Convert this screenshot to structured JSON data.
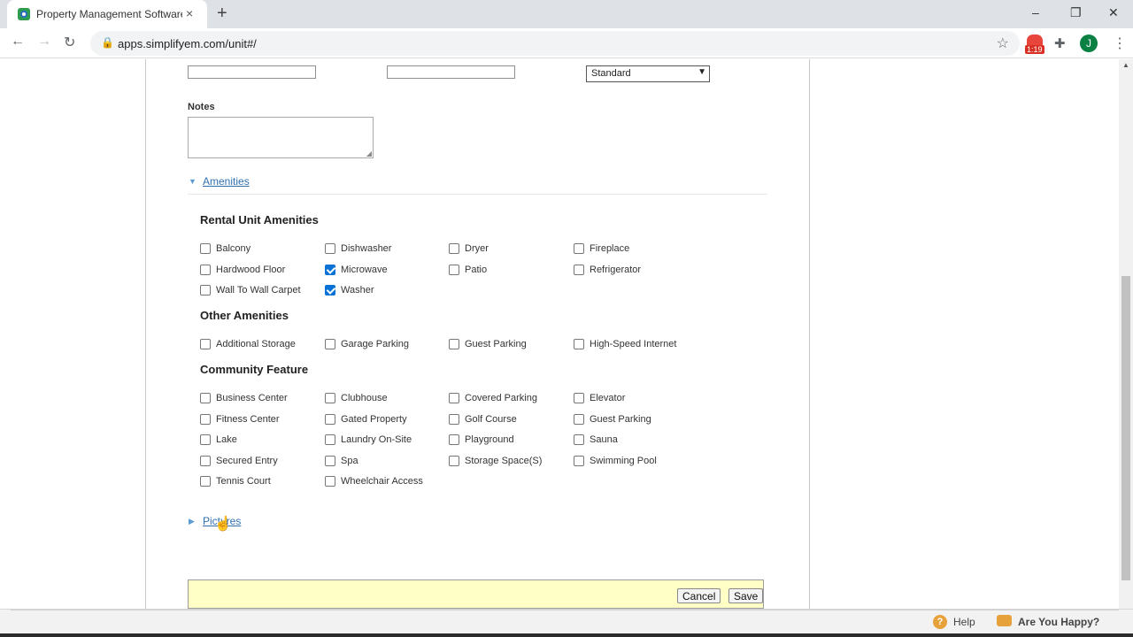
{
  "browser": {
    "tab_title": "Property Management Software",
    "tab_close": "×",
    "new_tab": "+",
    "url": "apps.simplifyem.com/unit#/",
    "extension_badge": "1:19",
    "avatar_letter": "J",
    "window_controls": {
      "minimize": "–",
      "maximize": "❐",
      "close": "✕"
    },
    "nav": {
      "back": "←",
      "forward": "→",
      "reload": "↻"
    }
  },
  "form": {
    "unit_type_select": {
      "value": "Standard"
    },
    "notes": {
      "label": "Notes",
      "value": ""
    },
    "amenities_toggle": "Amenities",
    "pictures_toggle": "Pictures"
  },
  "groups": {
    "rental": {
      "title": "Rental Unit Amenities",
      "items": [
        {
          "label": "Balcony",
          "checked": false
        },
        {
          "label": "Dishwasher",
          "checked": false
        },
        {
          "label": "Dryer",
          "checked": false
        },
        {
          "label": "Fireplace",
          "checked": false
        },
        {
          "label": "Hardwood Floor",
          "checked": false
        },
        {
          "label": "Microwave",
          "checked": true
        },
        {
          "label": "Patio",
          "checked": false
        },
        {
          "label": "Refrigerator",
          "checked": false
        },
        {
          "label": "Wall To Wall Carpet",
          "checked": false
        },
        {
          "label": "Washer",
          "checked": true
        }
      ]
    },
    "other": {
      "title": "Other Amenities",
      "items": [
        {
          "label": "Additional Storage",
          "checked": false
        },
        {
          "label": "Garage Parking",
          "checked": false
        },
        {
          "label": "Guest Parking",
          "checked": false
        },
        {
          "label": "High-Speed Internet",
          "checked": false
        }
      ]
    },
    "community": {
      "title": "Community Feature",
      "items": [
        {
          "label": "Business Center",
          "checked": false
        },
        {
          "label": "Clubhouse",
          "checked": false
        },
        {
          "label": "Covered Parking",
          "checked": false
        },
        {
          "label": "Elevator",
          "checked": false
        },
        {
          "label": "Fitness Center",
          "checked": false
        },
        {
          "label": "Gated Property",
          "checked": false
        },
        {
          "label": "Golf Course",
          "checked": false
        },
        {
          "label": "Guest Parking",
          "checked": false
        },
        {
          "label": "Lake",
          "checked": false
        },
        {
          "label": "Laundry On-Site",
          "checked": false
        },
        {
          "label": "Playground",
          "checked": false
        },
        {
          "label": "Sauna",
          "checked": false
        },
        {
          "label": "Secured Entry",
          "checked": false
        },
        {
          "label": "Spa",
          "checked": false
        },
        {
          "label": "Storage Space(S)",
          "checked": false
        },
        {
          "label": "Swimming Pool",
          "checked": false
        },
        {
          "label": "Tennis Court",
          "checked": false
        },
        {
          "label": "Wheelchair Access",
          "checked": false
        }
      ]
    }
  },
  "actions": {
    "cancel": "Cancel",
    "save": "Save"
  },
  "footer": {
    "help": "Help",
    "help_icon": "?",
    "happy": "Are You Happy?"
  },
  "colors": {
    "accent": "#0a72d6",
    "link": "#3070b0",
    "action_bar": "#ffffc6"
  }
}
